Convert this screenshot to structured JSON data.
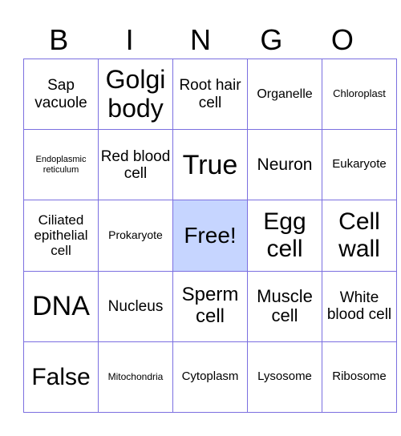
{
  "header": [
    "B",
    "I",
    "N",
    "G",
    "O"
  ],
  "free_color": "#c6d5ff",
  "grid_color": "#7b6fe0",
  "cells": [
    [
      {
        "text": "Sap vacuole",
        "size": 19
      },
      {
        "text": "Golgi body",
        "size": 32
      },
      {
        "text": "Root hair cell",
        "size": 19
      },
      {
        "text": "Organelle",
        "size": 16
      },
      {
        "text": "Chloroplast",
        "size": 13
      }
    ],
    [
      {
        "text": "Endoplasmic reticulum",
        "size": 11
      },
      {
        "text": "Red blood cell",
        "size": 19
      },
      {
        "text": "True",
        "size": 34
      },
      {
        "text": "Neuron",
        "size": 21
      },
      {
        "text": "Eukaryote",
        "size": 15
      }
    ],
    [
      {
        "text": "Ciliated epithelial cell",
        "size": 17
      },
      {
        "text": "Prokaryote",
        "size": 14
      },
      {
        "text": "Free!",
        "size": 28,
        "free": true
      },
      {
        "text": "Egg cell",
        "size": 30
      },
      {
        "text": "Cell wall",
        "size": 30
      }
    ],
    [
      {
        "text": "DNA",
        "size": 34
      },
      {
        "text": "Nucleus",
        "size": 19
      },
      {
        "text": "Sperm cell",
        "size": 24
      },
      {
        "text": "Muscle cell",
        "size": 22
      },
      {
        "text": "White blood cell",
        "size": 19
      }
    ],
    [
      {
        "text": "False",
        "size": 30
      },
      {
        "text": "Mitochondria",
        "size": 12
      },
      {
        "text": "Cytoplasm",
        "size": 15
      },
      {
        "text": "Lysosome",
        "size": 15
      },
      {
        "text": "Ribosome",
        "size": 15
      }
    ]
  ]
}
